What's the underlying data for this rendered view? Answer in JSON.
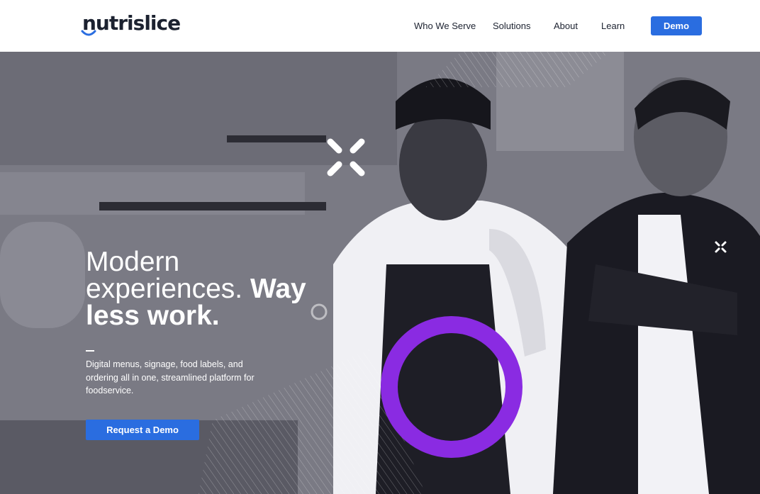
{
  "brand": {
    "logo_text": "nutrislice",
    "accent_color": "#2a6de0",
    "ring_color": "#8a2be2"
  },
  "nav": {
    "items": [
      {
        "label": "Who We Serve"
      },
      {
        "label": "Solutions"
      },
      {
        "label": "About"
      },
      {
        "label": "Learn"
      }
    ],
    "demo_label": "Demo"
  },
  "hero": {
    "title_light_1": "Modern experiences.",
    "title_bold_1": "Way",
    "title_bold_2": "less work.",
    "subtitle": "Digital menus, signage, food labels, and ordering all in one, streamlined platform for foodservice.",
    "cta_label": "Request a Demo",
    "decor_icons": [
      "x-mark-icon",
      "x-mark-icon",
      "ring-shape"
    ]
  }
}
